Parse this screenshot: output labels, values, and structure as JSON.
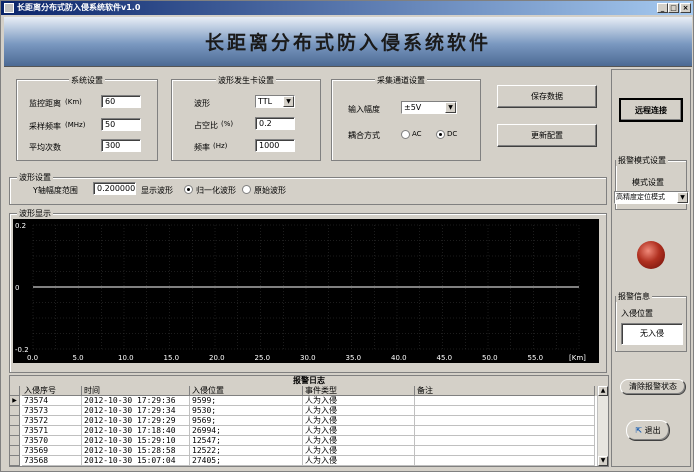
{
  "window": {
    "title": "长距离分布式防入侵系统软件v1.0"
  },
  "banner": {
    "title": "长距离分布式防入侵系统软件"
  },
  "system_settings": {
    "title": "系统设置",
    "distance_label": "监控距离",
    "distance_unit": "(Km)",
    "distance_value": "60",
    "sample_label": "采样频率",
    "sample_unit": "(MHz)",
    "sample_value": "50",
    "avg_label": "平均次数",
    "avg_value": "300"
  },
  "waveform_card": {
    "title": "波形发生卡设置",
    "wave_label": "波形",
    "wave_value": "TTL",
    "duty_label": "占空比",
    "duty_unit": "(%)",
    "duty_value": "0.2",
    "freq_label": "频率",
    "freq_unit": "(Hz)",
    "freq_value": "1000"
  },
  "acq_channel": {
    "title": "采集通道设置",
    "range_label": "输入幅度",
    "range_value": "±5V",
    "coupling_label": "耦合方式",
    "ac_label": "AC",
    "dc_label": "DC",
    "coupling_selected": "DC"
  },
  "buttons": {
    "save": "保存数据",
    "update": "更新配置",
    "remote": "远程连接",
    "clear_alarm": "清除报警状态",
    "exit": "退出"
  },
  "wave_settings": {
    "title": "波形设置",
    "yrange_label": "Y轴幅度范围",
    "yrange_value": "0.200000",
    "display_label": "显示波形",
    "normalized_label": "归一化波形",
    "raw_label": "原始波形",
    "selected": "normalized"
  },
  "wave_display": {
    "title": "波形显示"
  },
  "chart_data": {
    "type": "line",
    "title": "",
    "xlabel": "[Km]",
    "ylabel": "",
    "x_ticks": [
      "0.0",
      "5.0",
      "10.0",
      "15.0",
      "20.0",
      "25.0",
      "30.0",
      "35.0",
      "40.0",
      "45.0",
      "50.0",
      "55.0"
    ],
    "y_ticks": [
      "0.2",
      "0",
      "-0.2"
    ],
    "xlim": [
      0,
      60
    ],
    "ylim": [
      -0.2,
      0.2
    ],
    "grid": true,
    "series": [
      {
        "x": [
          0,
          60
        ],
        "y": [
          0,
          0
        ]
      }
    ],
    "colors": {
      "background": "#000000",
      "grid": "#3a3a3a",
      "line": "#ffffff",
      "axis_text": "#ffffff"
    }
  },
  "alarm_mode": {
    "title": "报警模式设置",
    "mode_label": "模式设置",
    "mode_value": "高精度定位模式"
  },
  "alarm_info": {
    "title": "报警信息",
    "position_label": "入侵位置",
    "status": "无入侵"
  },
  "log": {
    "caption": "报警日志",
    "columns": [
      "入侵序号",
      "时间",
      "入侵位置",
      "事件类型",
      "备注"
    ],
    "rows": [
      [
        "73574",
        "2012-10-30 17:29:36",
        "9599;",
        "人为入侵",
        ""
      ],
      [
        "73573",
        "2012-10-30 17:29:34",
        "9530;",
        "人为入侵",
        ""
      ],
      [
        "73572",
        "2012-10-30 17:29:29",
        "9569;",
        "人为入侵",
        ""
      ],
      [
        "73571",
        "2012-10-30 17:18:40",
        "26994;",
        "人为入侵",
        ""
      ],
      [
        "73570",
        "2012-10-30 15:29:10",
        "12547;",
        "人为入侵",
        ""
      ],
      [
        "73569",
        "2012-10-30 15:28:58",
        "12522;",
        "人为入侵",
        ""
      ],
      [
        "73568",
        "2012-10-30 15:07:04",
        "27405;",
        "人为入侵",
        ""
      ]
    ]
  }
}
